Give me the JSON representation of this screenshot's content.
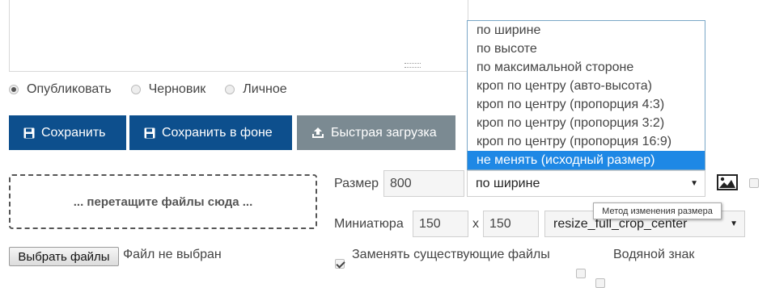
{
  "status_options": [
    {
      "label": "Опубликовать",
      "checked": true
    },
    {
      "label": "Черновик",
      "checked": false
    },
    {
      "label": "Личное",
      "checked": false
    }
  ],
  "buttons": {
    "save": "Сохранить",
    "save_background": "Сохранить в фоне",
    "quick_upload": "Быстрая загрузка",
    "save_icon": "floppy-disk-icon",
    "upload_icon": "upload-icon"
  },
  "dropzone": {
    "text": "... перетащите файлы сюда ..."
  },
  "file_input": {
    "button": "Выбрать файлы",
    "status": "Файл не выбран"
  },
  "size": {
    "label": "Размер",
    "value": "800"
  },
  "resize_mode": {
    "selected": "по ширине",
    "tooltip": "Метод изменения размера",
    "options": [
      "по ширине",
      "по высоте",
      "по максимальной стороне",
      "кроп по центру (авто-высота)",
      "кроп по центру (пропорция 4:3)",
      "кроп по центру (пропорция 3:2)",
      "кроп по центру (пропорция 16:9)",
      "не менять (исходный размер)"
    ],
    "highlighted": "не менять (исходный размер)"
  },
  "thumbnail": {
    "label": "Миниатюра",
    "width": "150",
    "separator": "x",
    "height": "150",
    "mode": "resize_full_crop_center"
  },
  "options": {
    "replace_files": {
      "label": "Заменять существующие файлы",
      "checked": true
    },
    "extra_checkbox_checked": false,
    "watermark": {
      "label": "Водяной знак",
      "checked": false
    }
  },
  "icons": {
    "image": "image-icon"
  },
  "colors": {
    "primary": "#0d4f8d",
    "secondary": "#7b8a92",
    "highlight": "#1e88e5"
  }
}
